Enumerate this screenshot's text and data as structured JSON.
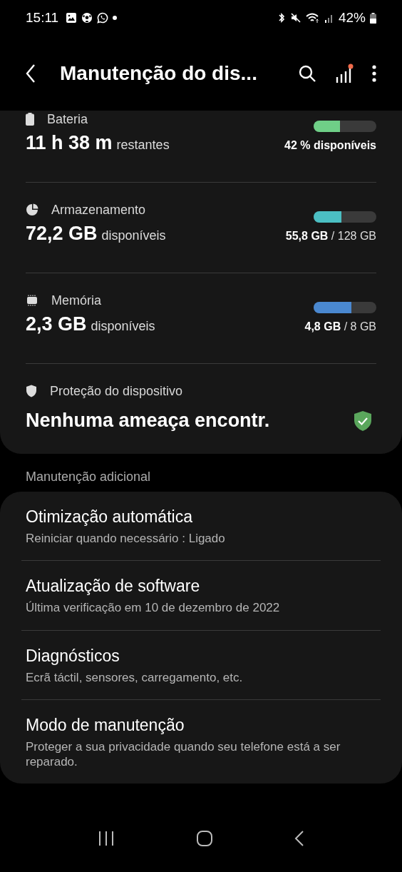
{
  "status_bar": {
    "time": "15:11",
    "battery_text": "42%"
  },
  "app_bar": {
    "title": "Manutenção do dis...",
    "notification_dot": true
  },
  "summary": [
    {
      "kind": "meter",
      "label": "Bateria",
      "value": "11 h 38 m",
      "unit": "restantes",
      "level": 0.42,
      "color": "#6fcf87",
      "reading": "42 % disponíveis",
      "reading_bold": true
    },
    {
      "kind": "meter",
      "label": "Armazenamento",
      "value": "72,2 GB",
      "unit": "disponíveis",
      "level": 0.44,
      "color": "#4bbfc3",
      "reading": "**55,8 GB** / 128 GB",
      "reading_bold": false
    },
    {
      "kind": "meter",
      "label": "Memória",
      "value": "2,3 GB",
      "unit": "disponíveis",
      "level": 0.6,
      "color": "#4a88d0",
      "reading": "**4,8 GB** / 8 GB",
      "reading_bold": false
    },
    {
      "kind": "status",
      "label": "Proteção do dispositivo",
      "value": "Nenhuma ameaça encontr."
    }
  ],
  "section_title": "Manutenção adicional",
  "items": [
    {
      "title": "Otimização automática",
      "subtitle": "Reiniciar quando necessário : Ligado"
    },
    {
      "title": "Atualização de software",
      "subtitle": "Última verificação em 10 de dezembro de 2022"
    },
    {
      "title": "Diagnósticos",
      "subtitle": "Ecrã táctil, sensores, carregamento, etc."
    },
    {
      "title": "Modo de manutenção",
      "subtitle": "Proteger a sua privacidade quando seu telefone está a ser reparado."
    }
  ]
}
